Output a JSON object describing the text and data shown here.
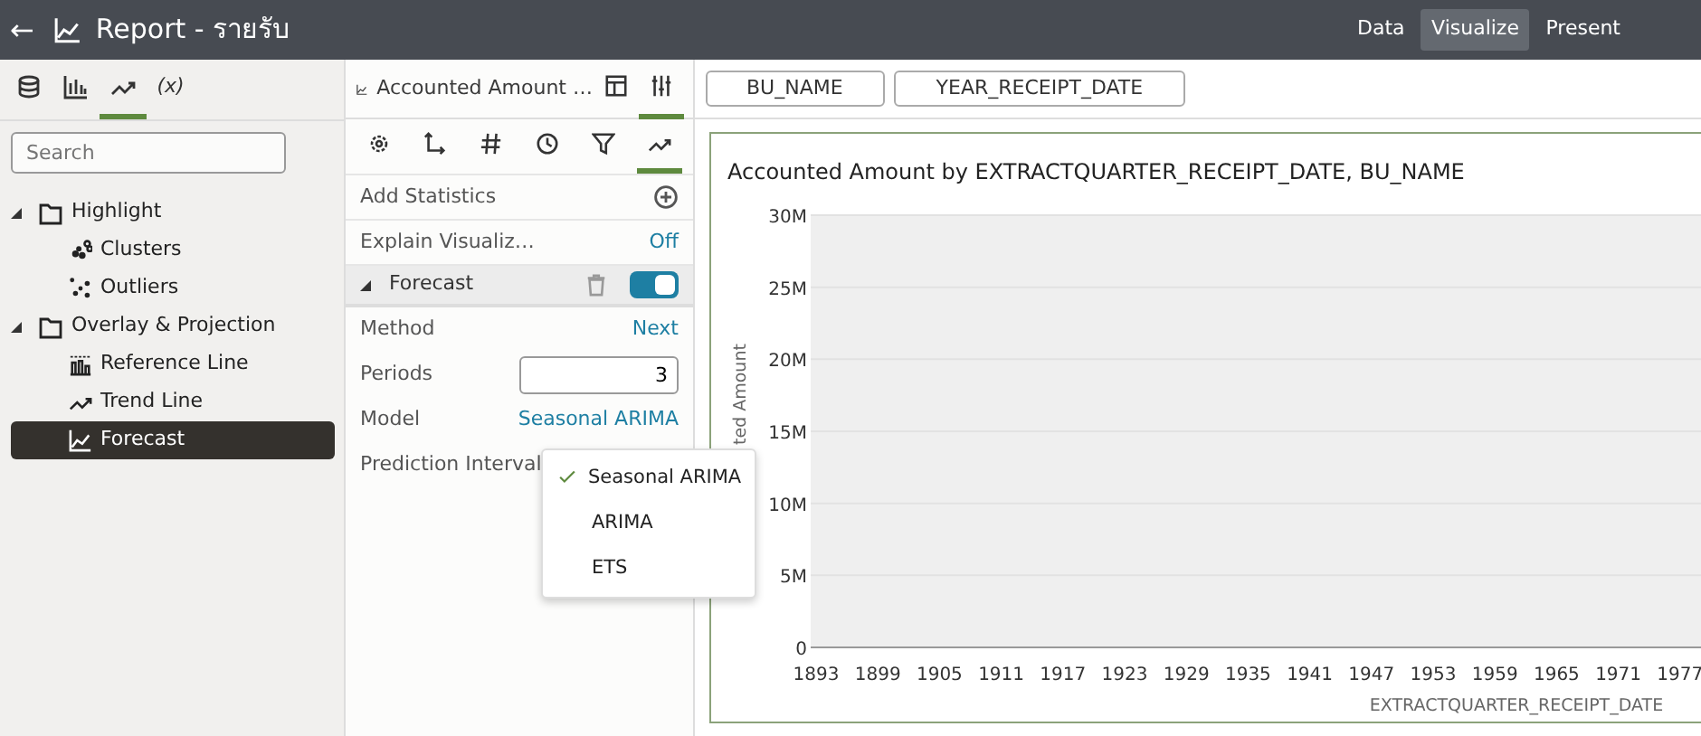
{
  "header": {
    "back": "←",
    "title": "Report - รายรับ",
    "nav": [
      {
        "label": "Data",
        "selected": false
      },
      {
        "label": "Visualize",
        "selected": true
      },
      {
        "label": "Present",
        "selected": false
      }
    ]
  },
  "left_panel": {
    "tabs": [
      {
        "kind": "database",
        "selected": false
      },
      {
        "kind": "bars",
        "selected": false
      },
      {
        "kind": "trend",
        "selected": true
      },
      {
        "kind": "text",
        "label": "(x)",
        "selected": false
      }
    ],
    "search": {
      "placeholder": "Search"
    },
    "tree": [
      {
        "label": "Highlight",
        "expanded": true,
        "children": [
          {
            "label": "Clusters",
            "kind": "clusters",
            "selected": false
          },
          {
            "label": "Outliers",
            "kind": "outliers",
            "selected": false
          }
        ]
      },
      {
        "label": "Overlay & Projection",
        "expanded": true,
        "children": [
          {
            "label": "Reference Line",
            "kind": "reference",
            "selected": false
          },
          {
            "label": "Trend Line",
            "kind": "trend",
            "selected": false
          },
          {
            "label": "Forecast",
            "kind": "forecast",
            "selected": true
          }
        ]
      }
    ]
  },
  "properties": {
    "title": "Accounted Amount …",
    "header_tabs": [
      {
        "kind": "layout",
        "selected": false
      },
      {
        "kind": "sliders",
        "selected": true
      }
    ],
    "tabs": [
      {
        "kind": "gear",
        "selected": false
      },
      {
        "kind": "axis",
        "selected": false
      },
      {
        "kind": "hash",
        "selected": false
      },
      {
        "kind": "clock",
        "selected": false
      },
      {
        "kind": "filter",
        "selected": false
      },
      {
        "kind": "trend",
        "selected": true
      }
    ],
    "add_statistics": "Add Statistics",
    "explain": {
      "label": "Explain Visualiz…",
      "value": "Off"
    },
    "forecast": {
      "label": "Forecast",
      "expanded": true,
      "on": true,
      "fields": [
        {
          "label": "Method",
          "kind": "link",
          "value": "Next"
        },
        {
          "label": "Periods",
          "kind": "input",
          "value": "3"
        },
        {
          "label": "Model",
          "kind": "link",
          "value": "Seasonal ARIMA"
        },
        {
          "label": "Prediction Interval",
          "kind": "text"
        }
      ]
    },
    "dropdown": [
      {
        "label": "Seasonal ARIMA",
        "selected": true
      },
      {
        "label": "ARIMA",
        "selected": false
      },
      {
        "label": "ETS",
        "selected": false
      }
    ]
  },
  "filters": [
    "BU_NAME",
    "YEAR_RECEIPT_DATE"
  ],
  "chart": {
    "title": "Accounted Amount by EXTRACTQUARTER_RECEIPT_DATE, BU_NAME",
    "chart_data": {
      "type": "line",
      "xlabel": "EXTRACTQUARTER_RECEIPT_DATE",
      "ylabel": "ted Amount",
      "categories": [
        "1893",
        "1899",
        "1905",
        "1911",
        "1917",
        "1923",
        "1929",
        "1935",
        "1941",
        "1947",
        "1953",
        "1959",
        "1965",
        "1971",
        "1977"
      ],
      "ylim": [
        0,
        30000000
      ],
      "grid": true,
      "yticks": [
        {
          "value": 0,
          "label": "0"
        },
        {
          "value": 5000000,
          "label": "5M"
        },
        {
          "value": 10000000,
          "label": "10M"
        },
        {
          "value": 15000000,
          "label": "15M"
        },
        {
          "value": 20000000,
          "label": "20M"
        },
        {
          "value": 25000000,
          "label": "25M"
        },
        {
          "value": 30000000,
          "label": "30M"
        }
      ]
    }
  }
}
